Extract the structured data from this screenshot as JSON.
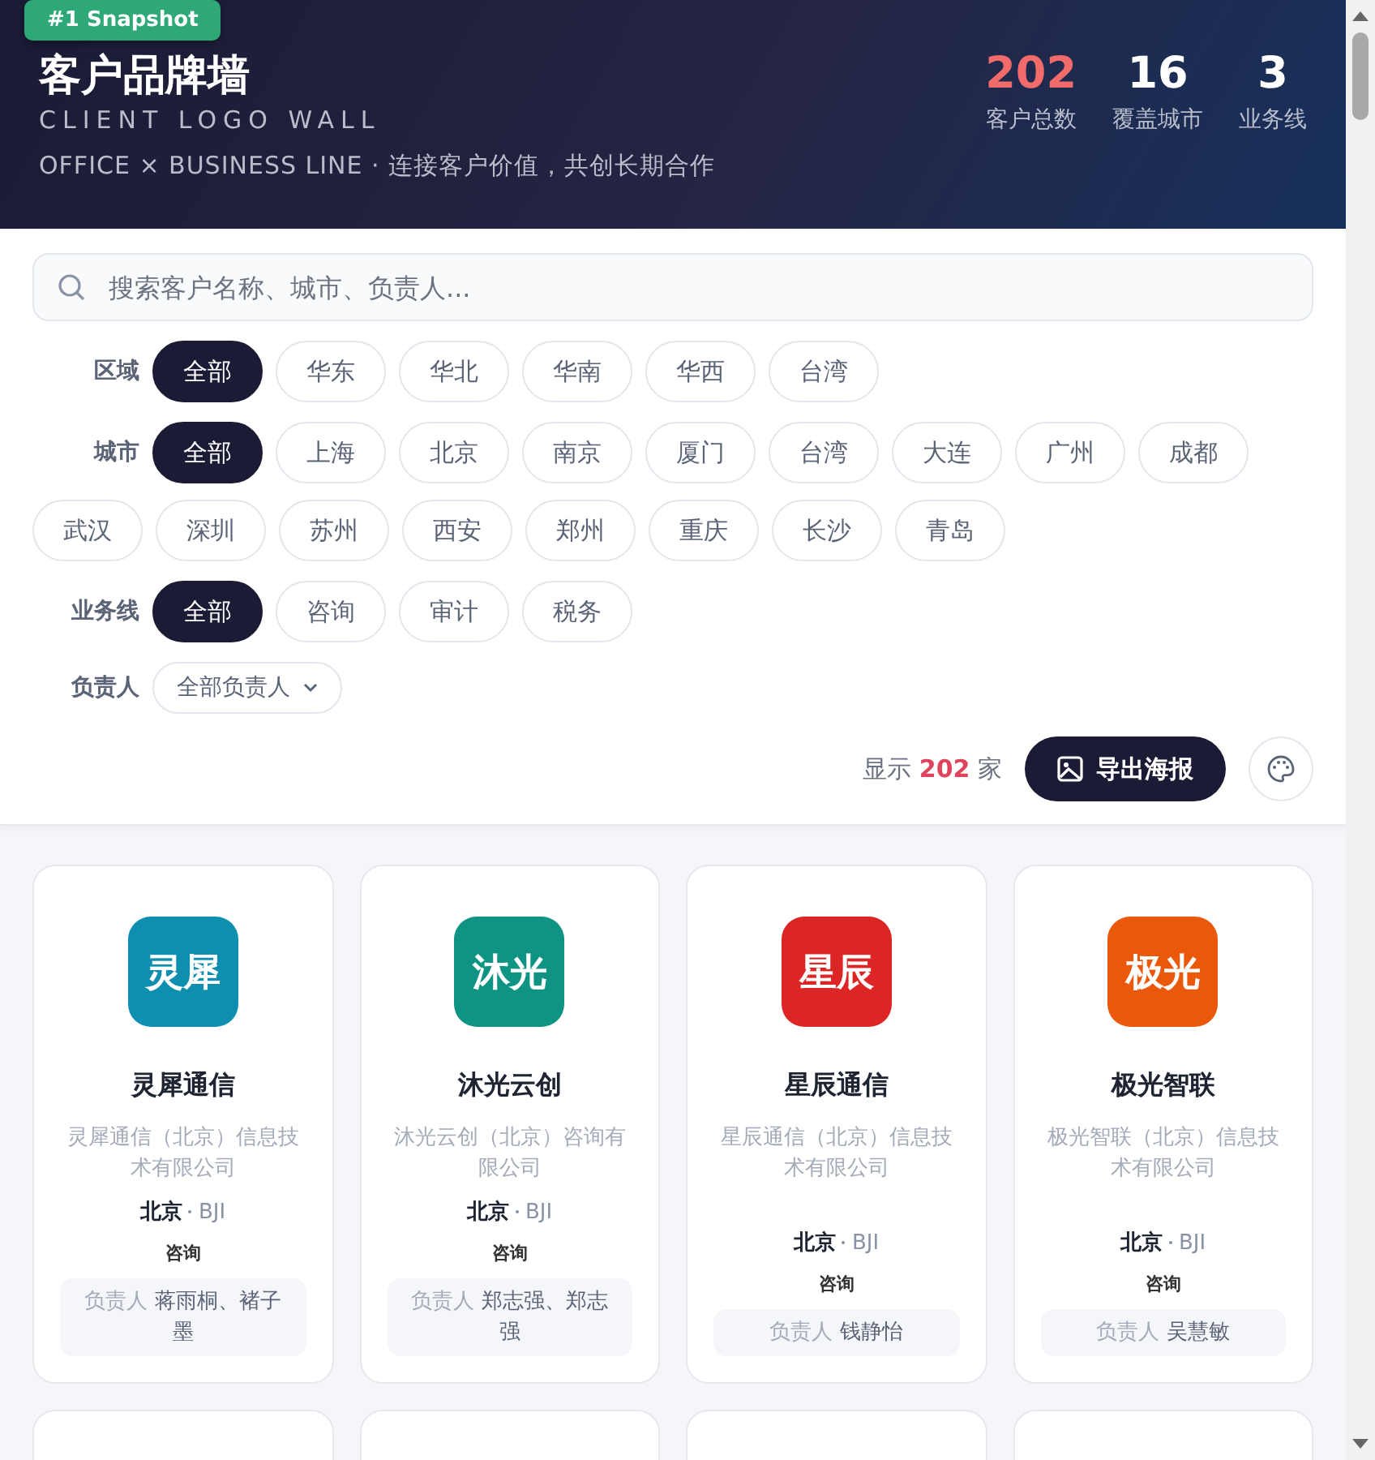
{
  "badge": "#1 Snapshot",
  "header": {
    "title": "客户品牌墙",
    "subtitle": "CLIENT LOGO WALL",
    "tagline": "OFFICE × BUSINESS LINE · 连接客户价值，共创长期合作",
    "stats": [
      {
        "value": "202",
        "label": "客户总数",
        "highlight": true
      },
      {
        "value": "16",
        "label": "覆盖城市",
        "highlight": false
      },
      {
        "value": "3",
        "label": "业务线",
        "highlight": false
      }
    ]
  },
  "search": {
    "placeholder": "搜索客户名称、城市、负责人..."
  },
  "filters": [
    {
      "label": "区域",
      "options": [
        {
          "label": "全部",
          "selected": true
        },
        {
          "label": "华东",
          "selected": false
        },
        {
          "label": "华北",
          "selected": false
        },
        {
          "label": "华南",
          "selected": false
        },
        {
          "label": "华西",
          "selected": false
        },
        {
          "label": "台湾",
          "selected": false
        }
      ]
    },
    {
      "label": "城市",
      "options": [
        {
          "label": "全部",
          "selected": true
        },
        {
          "label": "上海",
          "selected": false
        },
        {
          "label": "北京",
          "selected": false
        },
        {
          "label": "南京",
          "selected": false
        },
        {
          "label": "厦门",
          "selected": false
        },
        {
          "label": "台湾",
          "selected": false
        },
        {
          "label": "大连",
          "selected": false
        },
        {
          "label": "广州",
          "selected": false
        },
        {
          "label": "成都",
          "selected": false
        },
        {
          "label": "武汉",
          "selected": false
        },
        {
          "label": "深圳",
          "selected": false
        },
        {
          "label": "苏州",
          "selected": false
        },
        {
          "label": "西安",
          "selected": false
        },
        {
          "label": "郑州",
          "selected": false
        },
        {
          "label": "重庆",
          "selected": false
        },
        {
          "label": "长沙",
          "selected": false
        },
        {
          "label": "青岛",
          "selected": false
        }
      ]
    },
    {
      "label": "业务线",
      "options": [
        {
          "label": "全部",
          "selected": true
        },
        {
          "label": "咨询",
          "selected": false
        },
        {
          "label": "审计",
          "selected": false
        },
        {
          "label": "税务",
          "selected": false
        }
      ]
    }
  ],
  "owner_filter": {
    "label": "负责人",
    "value": "全部负责人"
  },
  "count_text": "显示 **202** 家",
  "export_button": "导出海报",
  "clients": [
    {
      "logo": "灵犀",
      "color": "#0e8fb0",
      "name": "灵犀通信",
      "full_name": "灵犀通信（北京）信息技术有限公司",
      "city": "北京",
      "code": "BJI",
      "business": "咨询",
      "owner_label": "负责人",
      "owners": "蒋雨桐、褚子墨"
    },
    {
      "logo": "沐光",
      "color": "#0f9484",
      "name": "沐光云创",
      "full_name": "沐光云创（北京）咨询有限公司",
      "city": "北京",
      "code": "BJI",
      "business": "咨询",
      "owner_label": "负责人",
      "owners": "郑志强、郑志强"
    },
    {
      "logo": "星辰",
      "color": "#dc2626",
      "name": "星辰通信",
      "full_name": "星辰通信（北京）信息技术有限公司",
      "city": "北京",
      "code": "BJI",
      "business": "咨询",
      "owner_label": "负责人",
      "owners": "钱静怡"
    },
    {
      "logo": "极光",
      "color": "#ea580c",
      "name": "极光智联",
      "full_name": "极光智联（北京）信息技术有限公司",
      "city": "北京",
      "code": "BJI",
      "business": "咨询",
      "owner_label": "负责人",
      "owners": "吴慧敏"
    }
  ]
}
